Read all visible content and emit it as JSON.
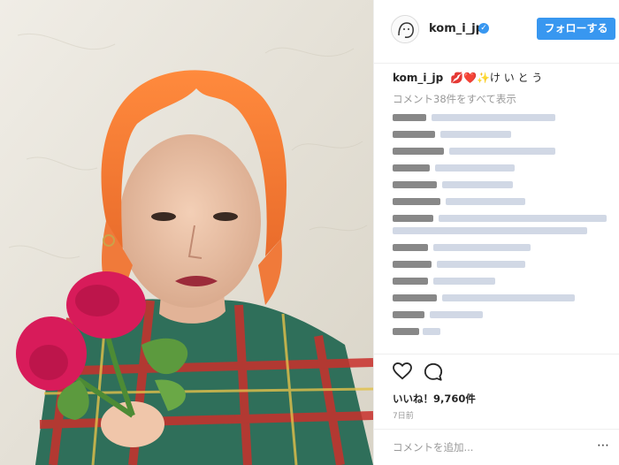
{
  "post": {
    "username": "kom_i_jp",
    "verified_icon": "verified-badge-icon",
    "follow_label": "フォローする",
    "caption_user": "kom_i_jp",
    "caption_text": "💋❤️✨け い と う",
    "view_all_comments": "コメント38件をすべて表示",
    "likes": "いいね！9,760件",
    "time_ago": "7日前",
    "comment_placeholder": "コメントを追加...",
    "more_icon": "⋯"
  },
  "colors": {
    "accent": "#3897f0",
    "hair": "#f07a3a",
    "flower": "#d81b5a",
    "wall": "#e9e6dc"
  }
}
